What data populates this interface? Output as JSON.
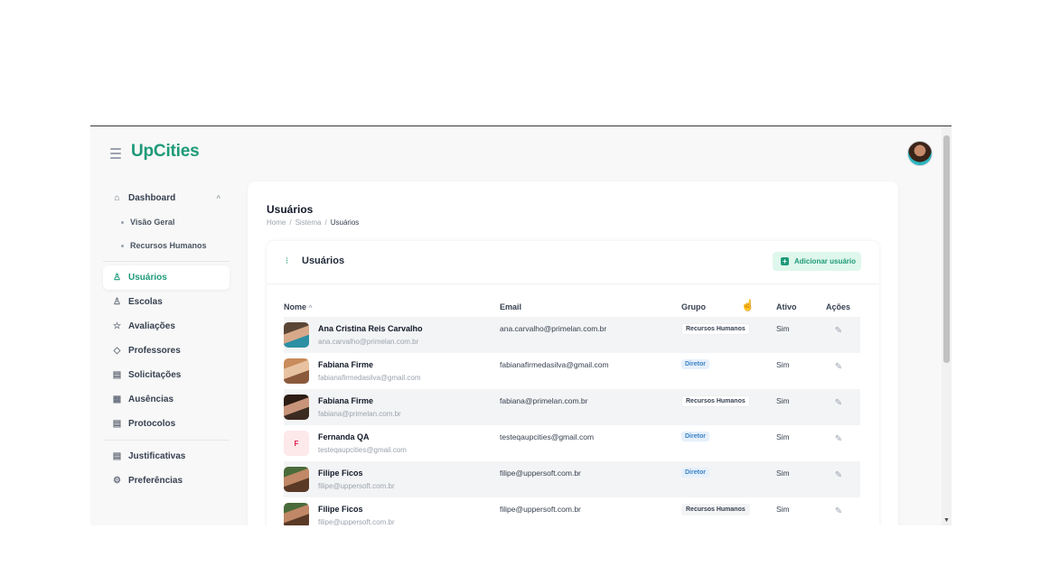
{
  "app": {
    "logo": "UpCities"
  },
  "sidebar": {
    "dashboard": {
      "label": "Dashboard",
      "icon": "home-icon"
    },
    "sub": [
      {
        "label": "Visão Geral"
      },
      {
        "label": "Recursos Humanos"
      }
    ],
    "items": [
      {
        "label": "Usuários",
        "icon": "user-icon",
        "active": true
      },
      {
        "label": "Escolas",
        "icon": "user-icon"
      },
      {
        "label": "Avaliações",
        "icon": "star-icon"
      },
      {
        "label": "Professores",
        "icon": "graduation-cap-icon"
      },
      {
        "label": "Solicitações",
        "icon": "document-icon"
      },
      {
        "label": "Ausências",
        "icon": "calendar-icon"
      },
      {
        "label": "Protocolos",
        "icon": "document-icon"
      }
    ],
    "items2": [
      {
        "label": "Justificativas",
        "icon": "document-icon"
      },
      {
        "label": "Preferências",
        "icon": "gear-icon"
      }
    ]
  },
  "page": {
    "title": "Usuários",
    "breadcrumb": {
      "home": "Home",
      "sep1": "/",
      "sistema": "Sistema",
      "sep2": "/",
      "current": "Usuários"
    }
  },
  "panel": {
    "title": "Usuários",
    "add_label": "Adicionar usuário"
  },
  "table": {
    "headers": {
      "nome": "Nome",
      "email": "Email",
      "grupo": "Grupo",
      "ativo": "Ativo",
      "acoes": "Ações"
    },
    "sort_indicator": "^",
    "rows": [
      {
        "name": "Ana Cristina Reis Carvalho",
        "sub_email": "ana.carvalho@primelan.com.br",
        "email": "ana.carvalho@primelan.com.br",
        "group": "Recursos Humanos",
        "active": "Sim"
      },
      {
        "name": "Fabiana Firme",
        "sub_email": "fabianafirmedasilva@gmail.com",
        "email": "fabianafirmedasilva@gmail.com",
        "group": "Diretor",
        "active": "Sim"
      },
      {
        "name": "Fabiana Firme",
        "sub_email": "fabiana@primelan.com.br",
        "email": "fabiana@primelan.com.br",
        "group": "Recursos Humanos",
        "active": "Sim"
      },
      {
        "name": "Fernanda QA",
        "initial": "F",
        "sub_email": "testeqaupcities@gmail.com",
        "email": "testeqaupcities@gmail.com",
        "group": "Diretor",
        "active": "Sim"
      },
      {
        "name": "Filipe Ficos",
        "sub_email": "filipe@uppersoft.com.br",
        "email": "filipe@uppersoft.com.br",
        "group": "Diretor",
        "active": "Sim"
      },
      {
        "name": "Filipe Ficos",
        "sub_email": "filipe@uppersoft.com.br",
        "email": "filipe@uppersoft.com.br",
        "group": "Recursos Humanos",
        "active": "Sim"
      }
    ]
  },
  "colors": {
    "brand": "#1e9a79",
    "director_badge": "#3b82c4",
    "add_button_bg": "#dff7ec"
  }
}
